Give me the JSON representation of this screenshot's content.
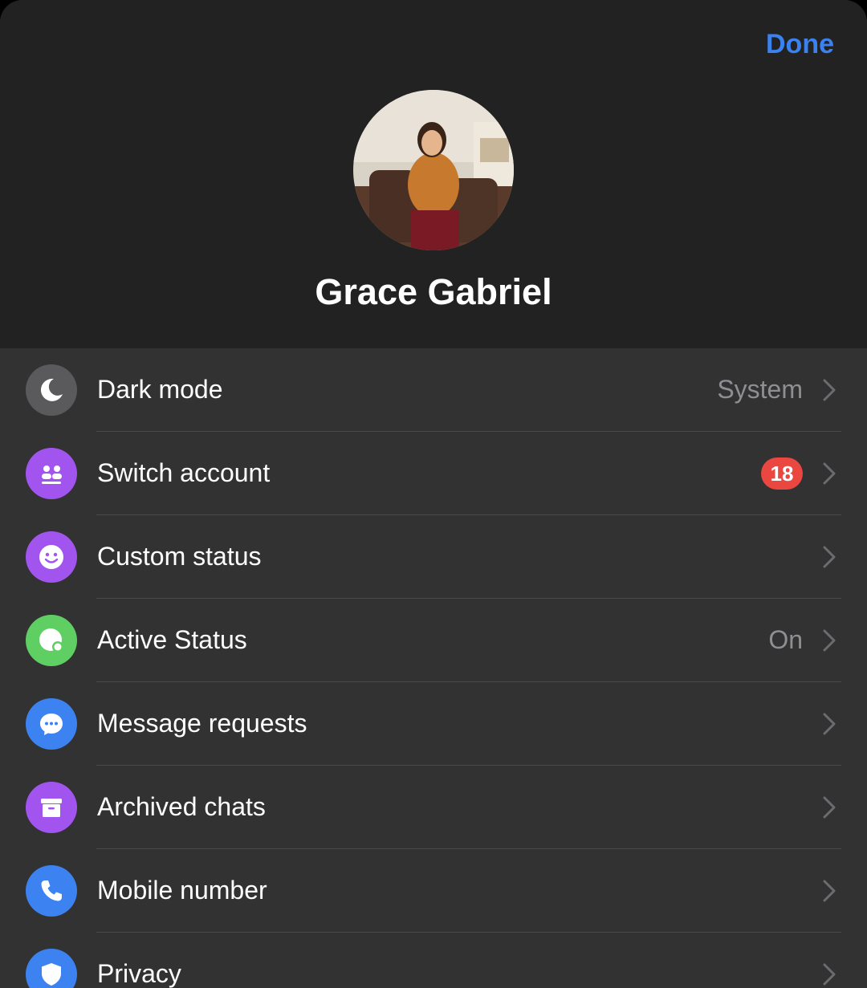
{
  "header": {
    "done_label": "Done",
    "user_name": "Grace Gabriel"
  },
  "colors": {
    "accent_blue": "#3b82f0",
    "badge_red": "#e9473f",
    "dark_mode_gray": "#5a5a5c",
    "purple": "#a154ee",
    "green": "#5fcf63",
    "blue": "#3c82f1"
  },
  "menu": [
    {
      "label": "Dark mode",
      "value": "System",
      "icon": "moon-icon"
    },
    {
      "label": "Switch account",
      "badge": "18",
      "icon": "switch-account-icon"
    },
    {
      "label": "Custom status",
      "icon": "smiley-icon"
    },
    {
      "label": "Active Status",
      "value": "On",
      "icon": "active-status-icon"
    },
    {
      "label": "Message requests",
      "icon": "chat-bubble-icon"
    },
    {
      "label": "Archived chats",
      "icon": "archive-box-icon"
    },
    {
      "label": "Mobile number",
      "icon": "phone-icon"
    },
    {
      "label": "Privacy",
      "icon": "shield-icon"
    }
  ]
}
